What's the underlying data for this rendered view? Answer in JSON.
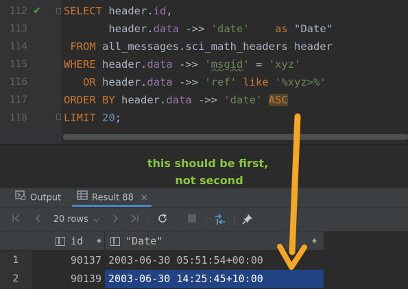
{
  "editor": {
    "lines": [
      {
        "num": "112",
        "check": true
      },
      {
        "num": "113"
      },
      {
        "num": "114"
      },
      {
        "num": "115"
      },
      {
        "num": "116"
      },
      {
        "num": "117"
      },
      {
        "num": "118"
      }
    ],
    "tokens": {
      "l112_kw": "SELECT",
      "l112_rest": " header.",
      "l112_fld": "id",
      "l112_comma": ",",
      "l113_pre": "       header.",
      "l113_fld": "data",
      "l113_op": " ->> ",
      "l113_str": "'date'",
      "l113_sp": "    ",
      "l113_as": "as",
      "l113_alias": " \"Date\"",
      "l114_kw": " FROM",
      "l114_rest": " all_messages.sci_math_headers header",
      "l115_kw": "WHERE",
      "l115_pre": " header.",
      "l115_fld": "data",
      "l115_op": " ->> ",
      "l115_q1": "'",
      "l115_sq": "msgid",
      "l115_q2": "'",
      "l115_eq": " = ",
      "l115_str": "'xyz'",
      "l116_kw": "   OR",
      "l116_pre": " header.",
      "l116_fld": "data",
      "l116_op": " ->> ",
      "l116_str": "'ref'",
      "l116_like": " like",
      "l116_str2": " '%xyz>%'",
      "l117_kw": "ORDER BY",
      "l117_pre": " header.",
      "l117_fld": "data",
      "l117_op": " ->> ",
      "l117_str": "'date'",
      "l117_sp": " ",
      "l117_asc": "ASC",
      "l118_kw": "LIMIT",
      "l118_sp": " ",
      "l118_num": "20",
      "l118_semi": ";"
    }
  },
  "annotation": {
    "line1": "this should be first,",
    "line2": "not second",
    "color": "#8ac73c",
    "arrow_color": "#f5a623"
  },
  "tabs": {
    "output_label": "Output",
    "result_label": "Result 88",
    "close_glyph": "✕"
  },
  "toolbar": {
    "first_glyph": "|<",
    "prev_glyph": "<",
    "rows_label": "20 rows",
    "next_glyph": ">",
    "last_glyph": ">|",
    "refresh_icon": "refresh-icon",
    "stop_icon": "stop-icon",
    "compare_icon": "compare-icon",
    "pin_icon": "pin-icon"
  },
  "grid": {
    "columns": [
      "id",
      "\"Date\""
    ],
    "rows": [
      {
        "num": "1",
        "id": "90137",
        "date": "2003-06-30 05:51:54+00:00"
      },
      {
        "num": "2",
        "id": "90139",
        "date": "2003-06-30 14:25:45+10:00"
      }
    ]
  },
  "colors": {
    "keyword": "#cc7832",
    "field": "#9876aa",
    "string": "#6a8759",
    "number": "#6897bb",
    "selection": "#214283"
  }
}
